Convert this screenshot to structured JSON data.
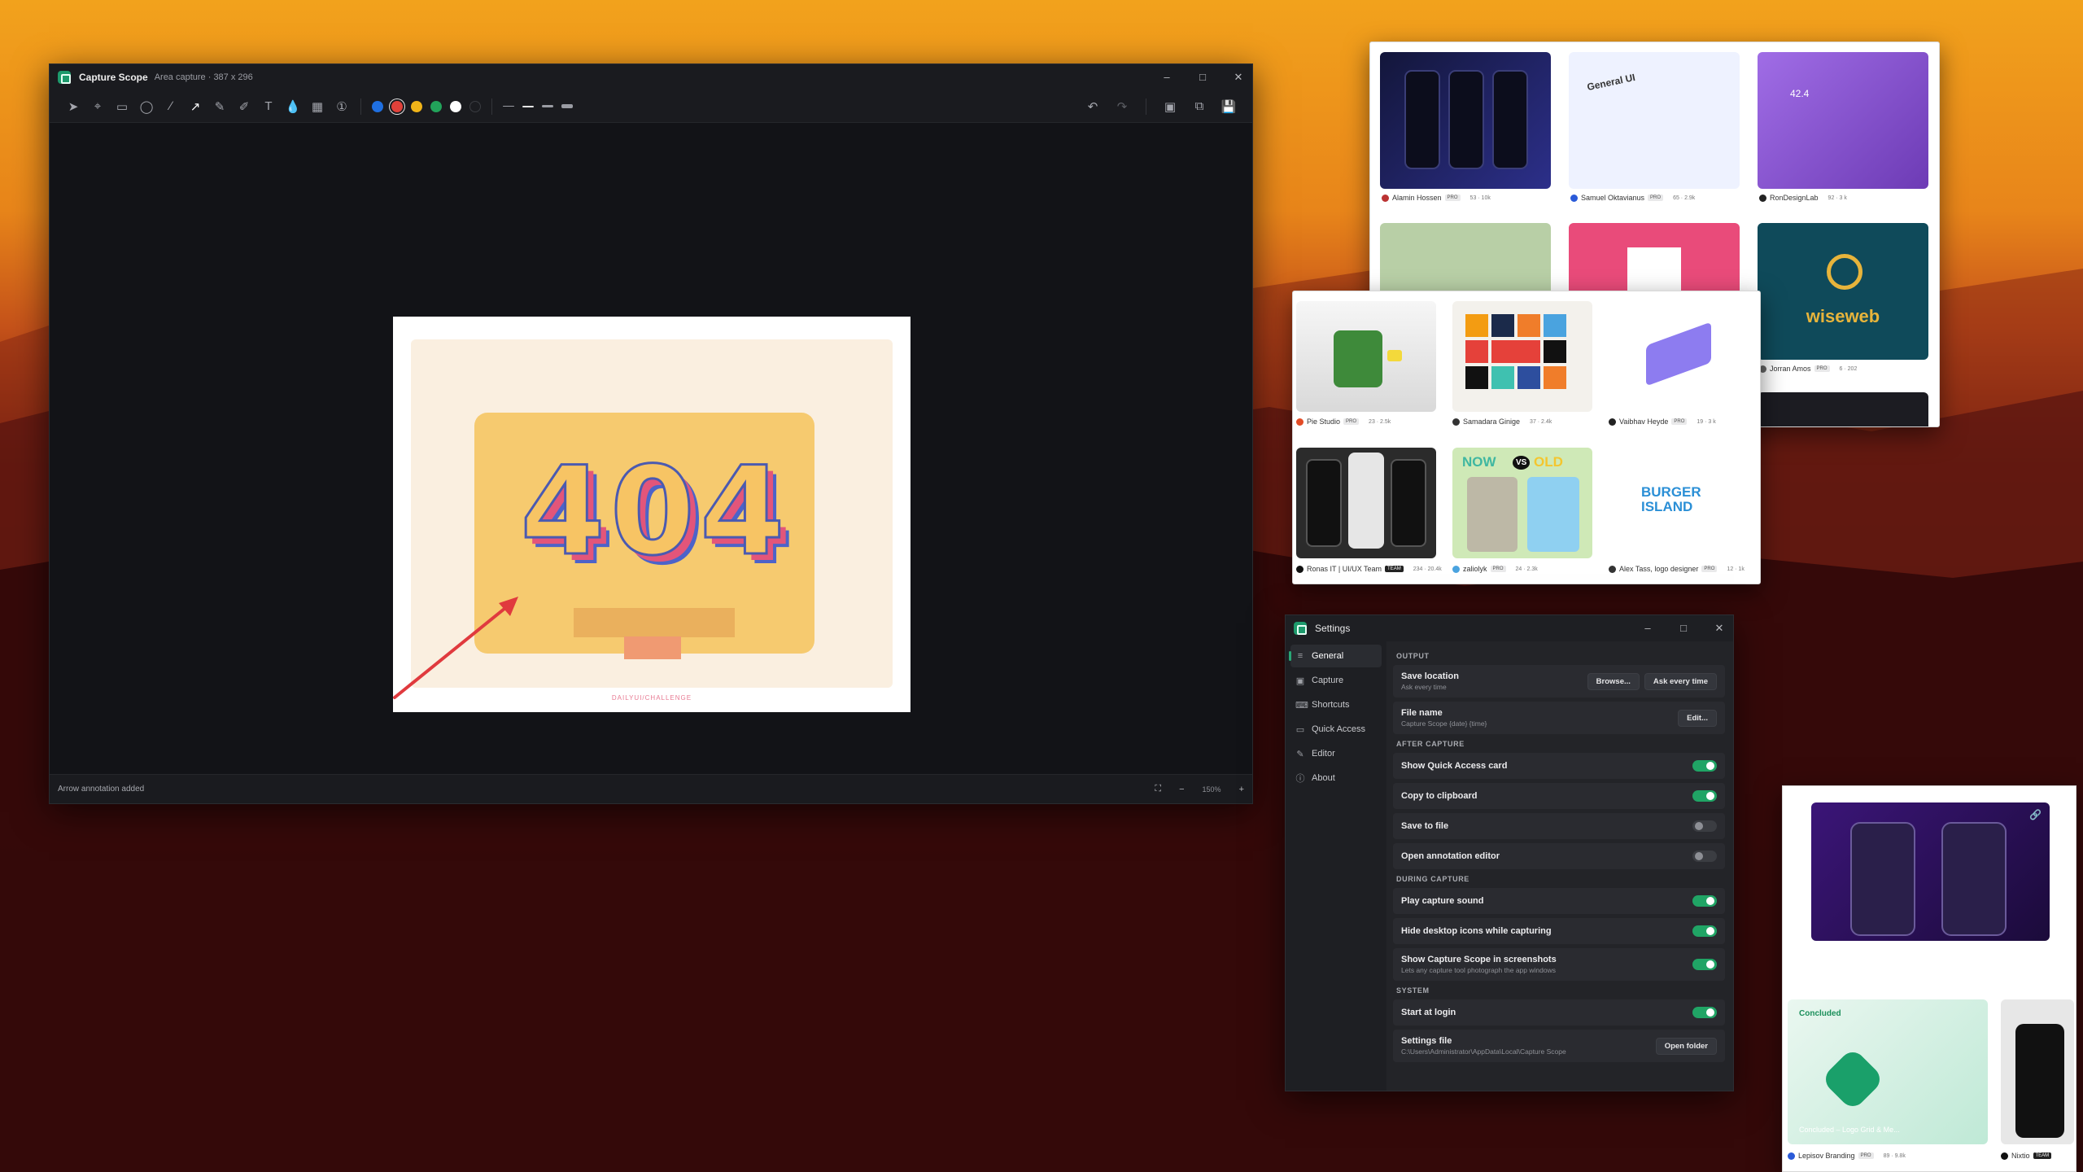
{
  "editor": {
    "app_name": "Capture Scope",
    "subtitle": "Area capture · 387 x 296",
    "status": "Arrow annotation added",
    "zoom_value": "150%",
    "capture_text": "404",
    "capture_footer": "DAILYUI/CHALLENGE",
    "tools": [
      "select-icon",
      "crop-icon",
      "rectangle-icon",
      "ellipse-icon",
      "line-icon",
      "arrow-icon",
      "pen-icon",
      "highlighter-icon",
      "text-icon",
      "blur-icon",
      "pixelate-icon",
      "step-number-icon"
    ],
    "active_tool": "arrow-icon",
    "colors": [
      "#1f6fe0",
      "#e0413a",
      "#f0b419",
      "#22a35a",
      "#ffffff",
      "#1b1c20"
    ],
    "selected_color": "#e0413a"
  },
  "shots_top": {
    "authors": [
      {
        "name": "Alamin Hossen",
        "badge": "PRO",
        "stats": "53 · 10k"
      },
      {
        "name": "Samuel Oktavianus",
        "badge": "PRO",
        "stats": "65 · 2.9k"
      },
      {
        "name": "RonDesignLab",
        "badge": "",
        "stats": "92 · 3 k"
      },
      {
        "name": "Jorran Amos",
        "badge": "PRO",
        "stats": "6 · 202"
      }
    ],
    "tile_text_1": "General UI",
    "tile_text_2": "42.4",
    "brand": "wiseweb"
  },
  "shots_mid": {
    "authors": [
      {
        "name": "Pie Studio",
        "badge": "PRO",
        "stats": "23 · 2.5k"
      },
      {
        "name": "Samadara Ginige",
        "badge": "",
        "stats": "37 · 2.4k"
      },
      {
        "name": "Vaibhav Heyde",
        "badge": "PRO",
        "stats": "19 · 3 k"
      },
      {
        "name": "Ronas IT | UI/UX Team",
        "badge": "TEAM",
        "stats": "234 · 20.4k"
      },
      {
        "name": "zaliolyk",
        "badge": "PRO",
        "stats": "24 · 2.3k"
      },
      {
        "name": "Alex Tass, logo designer",
        "badge": "PRO",
        "stats": "12 · 1k"
      }
    ],
    "now_text": "NOW",
    "vs_text": "VS",
    "old_text": "OLD",
    "burger_text": "BURGER ISLAND"
  },
  "shots_bottom": {
    "authors": [
      {
        "name": "Lepisov Branding",
        "badge": "PRO",
        "stats": "89 · 9.8k"
      },
      {
        "name": "Nixtio",
        "badge": "TEAM",
        "stats": ""
      }
    ],
    "concluded_label": "Concluded",
    "concluded_caption": "Concluded – Logo Grid & Me..."
  },
  "settings": {
    "title": "Settings",
    "nav": [
      {
        "label": "General",
        "icon": "sliders-icon"
      },
      {
        "label": "Capture",
        "icon": "capture-icon"
      },
      {
        "label": "Shortcuts",
        "icon": "keyboard-icon"
      },
      {
        "label": "Quick Access",
        "icon": "monitor-icon"
      },
      {
        "label": "Editor",
        "icon": "pencil-icon"
      },
      {
        "label": "About",
        "icon": "info-icon"
      }
    ],
    "sections": {
      "output": "OUTPUT",
      "after": "AFTER CAPTURE",
      "during": "DURING CAPTURE",
      "system": "SYSTEM"
    },
    "save_location": {
      "label": "Save location",
      "hint": "Ask every time",
      "browse": "Browse...",
      "ask": "Ask every time"
    },
    "file_name": {
      "label": "File name",
      "hint": "Capture Scope {date} {time}",
      "edit": "Edit..."
    },
    "show_quick_access": {
      "label": "Show Quick Access card",
      "on": true
    },
    "copy_clipboard": {
      "label": "Copy to clipboard",
      "on": true
    },
    "save_file": {
      "label": "Save to file",
      "on": false
    },
    "open_editor": {
      "label": "Open annotation editor",
      "on": false
    },
    "play_sound": {
      "label": "Play capture sound",
      "on": true
    },
    "hide_icons": {
      "label": "Hide desktop icons while capturing",
      "on": true
    },
    "show_in_shots": {
      "label": "Show Capture Scope in screenshots",
      "hint": "Lets any capture tool photograph the app windows",
      "on": true
    },
    "start_login": {
      "label": "Start at login",
      "on": true
    },
    "settings_file": {
      "label": "Settings file",
      "path": "C:\\Users\\Administrator\\AppData\\Local\\Capture Scope",
      "button": "Open folder"
    }
  }
}
